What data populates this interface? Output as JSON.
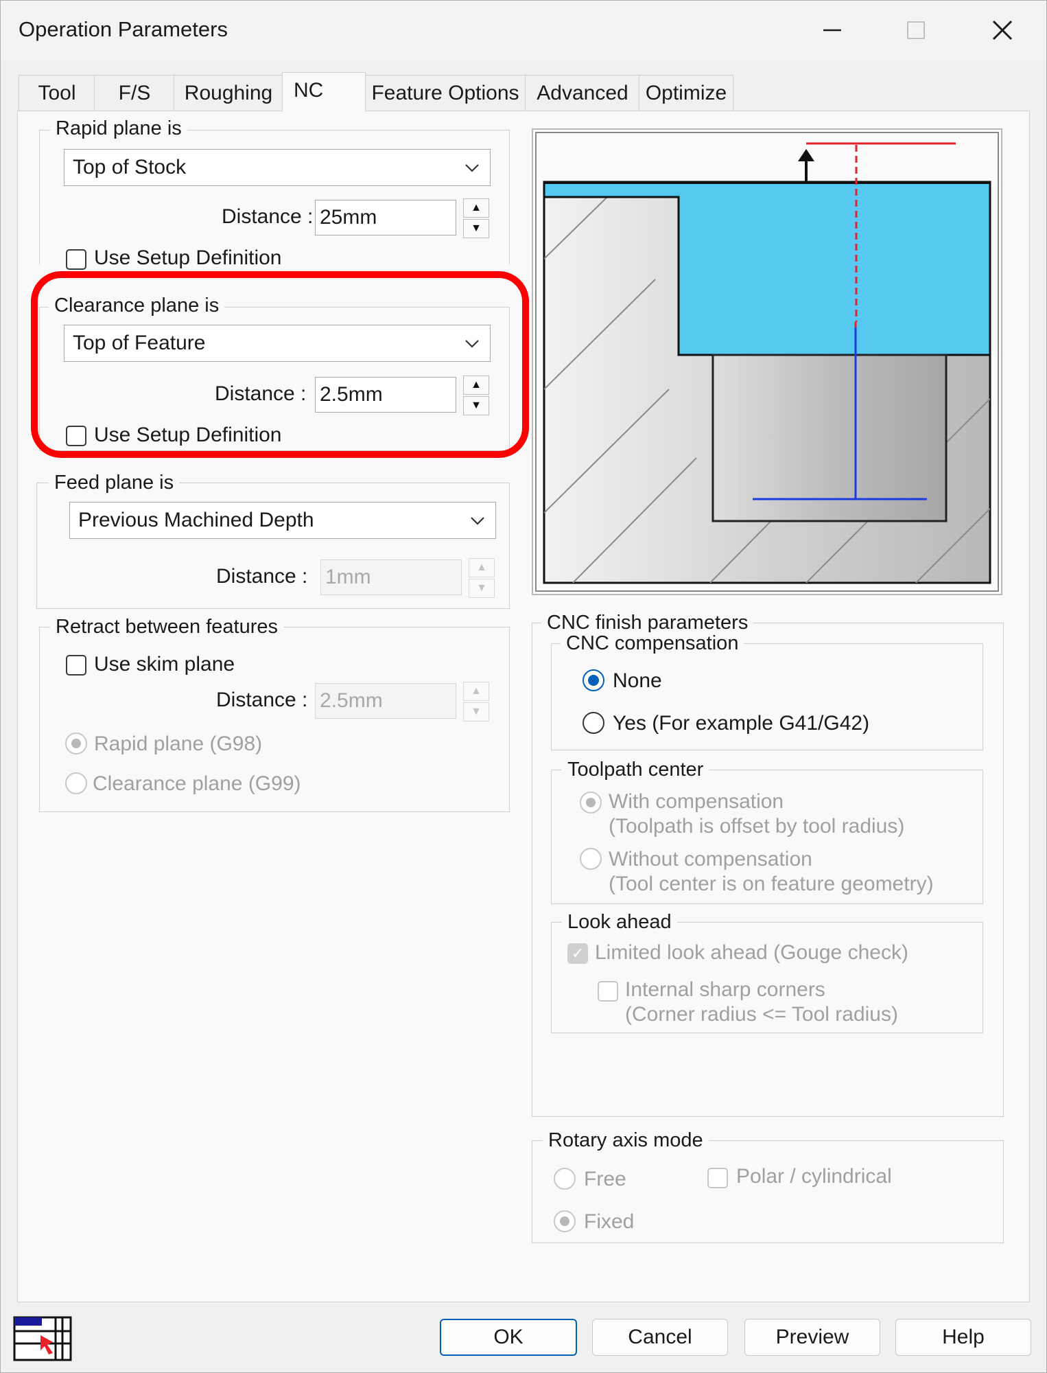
{
  "window": {
    "title": "Operation Parameters"
  },
  "tabs": [
    {
      "label": "Tool"
    },
    {
      "label": "F/S"
    },
    {
      "label": "Roughing"
    },
    {
      "label": "NC"
    },
    {
      "label": "Feature Options"
    },
    {
      "label": "Advanced"
    },
    {
      "label": "Optimize"
    }
  ],
  "rapid": {
    "legend": "Rapid plane is",
    "selected": "Top of Stock",
    "distance_label": "Distance :",
    "distance": "25mm",
    "use_setup": "Use Setup Definition"
  },
  "clearance": {
    "legend": "Clearance plane is",
    "selected": "Top of Feature",
    "distance_label": "Distance :",
    "distance": "2.5mm",
    "use_setup": "Use Setup Definition"
  },
  "feed": {
    "legend": "Feed plane is",
    "selected": "Previous Machined Depth",
    "distance_label": "Distance :",
    "distance": "1mm"
  },
  "retract": {
    "legend": "Retract between features",
    "use_skim": "Use skim plane",
    "distance_label": "Distance :",
    "distance": "2.5mm",
    "rapid_radio": "Rapid plane (G98)",
    "clearance_radio": "Clearance plane (G99)"
  },
  "cnc": {
    "legend": "CNC finish parameters",
    "compensation": {
      "legend": "CNC compensation",
      "none": "None",
      "yes": "Yes (For example G41/G42)"
    },
    "toolpath": {
      "legend": "Toolpath center",
      "with_line1": "With compensation",
      "with_line2": "(Toolpath is offset by tool radius)",
      "without_line1": "Without compensation",
      "without_line2": "(Tool center is on feature geometry)"
    },
    "lookahead": {
      "legend": "Look ahead",
      "limited": "Limited look ahead (Gouge check)",
      "internal_line1": "Internal sharp corners",
      "internal_line2": "(Corner radius <= Tool radius)"
    }
  },
  "rotary": {
    "legend": "Rotary axis mode",
    "free": "Free",
    "fixed": "Fixed",
    "polar": "Polar / cylindrical"
  },
  "buttons": {
    "ok": "OK",
    "cancel": "Cancel",
    "preview": "Preview",
    "help": "Help"
  },
  "colors": {
    "accent": "#005fb8",
    "highlight": "#ff0000",
    "stock_blue": "#55c8f0",
    "rapid_line": "#e8202a",
    "clearance_line": "#1a3ae0"
  }
}
